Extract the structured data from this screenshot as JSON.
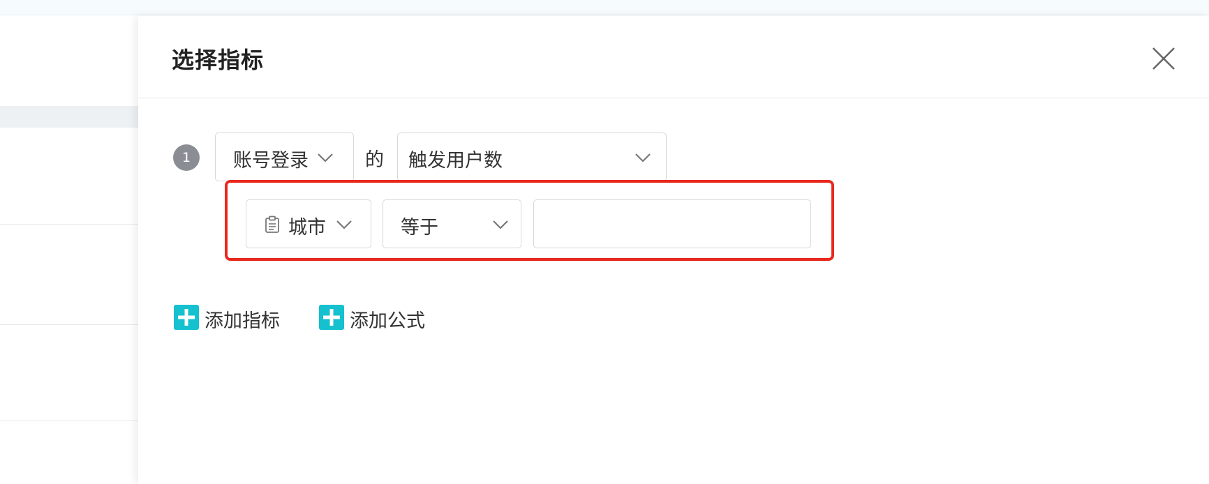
{
  "drawer": {
    "title": "选择指标",
    "close_label": "×"
  },
  "metric": {
    "index": "1",
    "event": "账号登录",
    "connector": "的",
    "measure": "触发用户数"
  },
  "filter": {
    "property": "城市",
    "operator": "等于",
    "value": "",
    "highlight_color": "#e8281d"
  },
  "actions": {
    "add_metric": "添加指标",
    "add_formula": "添加公式",
    "accent_color": "#15c0cf"
  }
}
